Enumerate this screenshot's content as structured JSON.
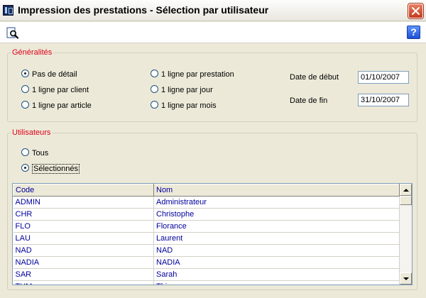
{
  "window": {
    "title": "Impression des prestations - Sélection par utilisateur",
    "icon": "app-icon",
    "close_icon": "close-icon"
  },
  "toolbar": {
    "preview_icon": "print-preview-icon",
    "help_label": "?"
  },
  "general": {
    "legend": "Généralités",
    "options": [
      {
        "label": "Pas de détail",
        "selected": true
      },
      {
        "label": "1 ligne par client",
        "selected": false
      },
      {
        "label": "1 ligne par article",
        "selected": false
      },
      {
        "label": "1 ligne par prestation",
        "selected": false
      },
      {
        "label": "1 ligne par jour",
        "selected": false
      },
      {
        "label": "1 ligne par mois",
        "selected": false
      }
    ],
    "start_label": "Date de début",
    "start_value": "01/10/2007",
    "end_label": "Date de fin",
    "end_value": "31/10/2007"
  },
  "users": {
    "legend": "Utilisateurs",
    "options": [
      {
        "label": "Tous",
        "selected": false
      },
      {
        "label": "Sélectionnés",
        "selected": true
      }
    ],
    "columns": [
      "Code",
      "Nom"
    ],
    "rows": [
      [
        "ADMIN",
        "Administrateur"
      ],
      [
        "CHR",
        "Christophe"
      ],
      [
        "FLO",
        "Florance"
      ],
      [
        "LAU",
        "Laurent"
      ],
      [
        "NAD",
        "NAD"
      ],
      [
        "NADIA",
        "NADIA"
      ],
      [
        "SAR",
        "Sarah"
      ],
      [
        "THM",
        "Thierry"
      ]
    ]
  },
  "colors": {
    "legend_text": "#e0001b",
    "grid_text": "#00009b",
    "window_bg": "#ece9d8"
  }
}
